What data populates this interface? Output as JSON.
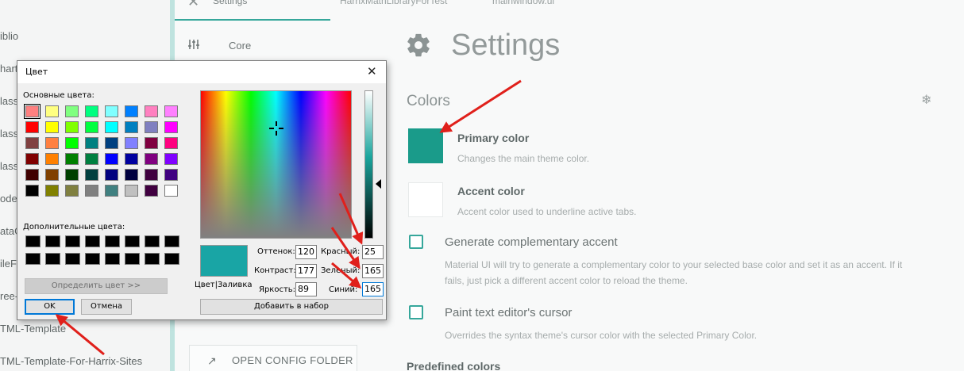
{
  "left_list": {
    "items": [
      "iblio",
      "hart",
      "lass",
      "lass",
      "lass",
      "ode",
      "ataG",
      "ileFo",
      "ree-V",
      "TML-Template",
      "TML-Template-For-Harrix-Sites"
    ]
  },
  "top_tabs": {
    "settings_label": "Settings",
    "tab2": "HarrixMathLibraryForTest",
    "tab3": "mainwindow.ui"
  },
  "sidebar": {
    "core_label": "Core",
    "open_config_label": "OPEN CONFIG FOLDER"
  },
  "settings": {
    "title": "Settings",
    "colors_heading": "Colors",
    "primary_title": "Primary color",
    "primary_desc": "Changes the main theme color.",
    "primary_color": "#1a9b8a",
    "accent_title": "Accent color",
    "accent_desc": "Accent color used to underline active tabs.",
    "accent_color": "#ffffff",
    "gen_accent_label": "Generate complementary accent",
    "gen_accent_desc_1": "Material UI will try to generate a complementary color to your selected base color and set it as an accent. If it",
    "gen_accent_desc_2": "fails, just pick a different accent color to reload the theme.",
    "paint_cursor_label": "Paint text editor's cursor",
    "paint_cursor_desc": "Overrides the syntax theme's cursor color with the selected Primary Color.",
    "predefined_heading": "Predefined colors"
  },
  "dialog": {
    "title": "Цвет",
    "close_glyph": "✕",
    "basic_label": "Основные цвета:",
    "basic_colors": [
      [
        "#ff8080",
        "#ffff80",
        "#80ff80",
        "#00ff80",
        "#80ffff",
        "#0080ff",
        "#ff80c0",
        "#ff80ff"
      ],
      [
        "#ff0000",
        "#ffff00",
        "#80ff00",
        "#00ff40",
        "#00ffff",
        "#0080c0",
        "#8080c0",
        "#ff00ff"
      ],
      [
        "#804040",
        "#ff8040",
        "#00ff00",
        "#008080",
        "#004080",
        "#8080ff",
        "#800040",
        "#ff0080"
      ],
      [
        "#800000",
        "#ff8000",
        "#008000",
        "#008040",
        "#0000ff",
        "#0000a0",
        "#800080",
        "#8000ff"
      ],
      [
        "#400000",
        "#804000",
        "#004000",
        "#004040",
        "#000080",
        "#000040",
        "#400040",
        "#400080"
      ],
      [
        "#000000",
        "#808000",
        "#808040",
        "#808080",
        "#408080",
        "#c0c0c0",
        "#400040",
        "#ffffff"
      ]
    ],
    "custom_label": "Дополнительные цвета:",
    "define_button": "Определить цвет >>",
    "ok_button": "OK",
    "cancel_button": "Отмена",
    "preview_label": "Цвет|Заливка",
    "preview_color": "#19a5a5",
    "hue_label": "Оттенок:",
    "hue_value": "120",
    "sat_label": "Контраст:",
    "sat_value": "177",
    "lum_label": "Яркость:",
    "lum_value": "89",
    "red_label": "Красный:",
    "red_value": "25",
    "green_label": "Зеленый:",
    "green_value": "165",
    "blue_label": "Синий:",
    "blue_value": "165",
    "add_button": "Добавить в набор"
  },
  "colors": {
    "accent_teal": "#36a79b",
    "annotation_red": "#e0201b"
  }
}
